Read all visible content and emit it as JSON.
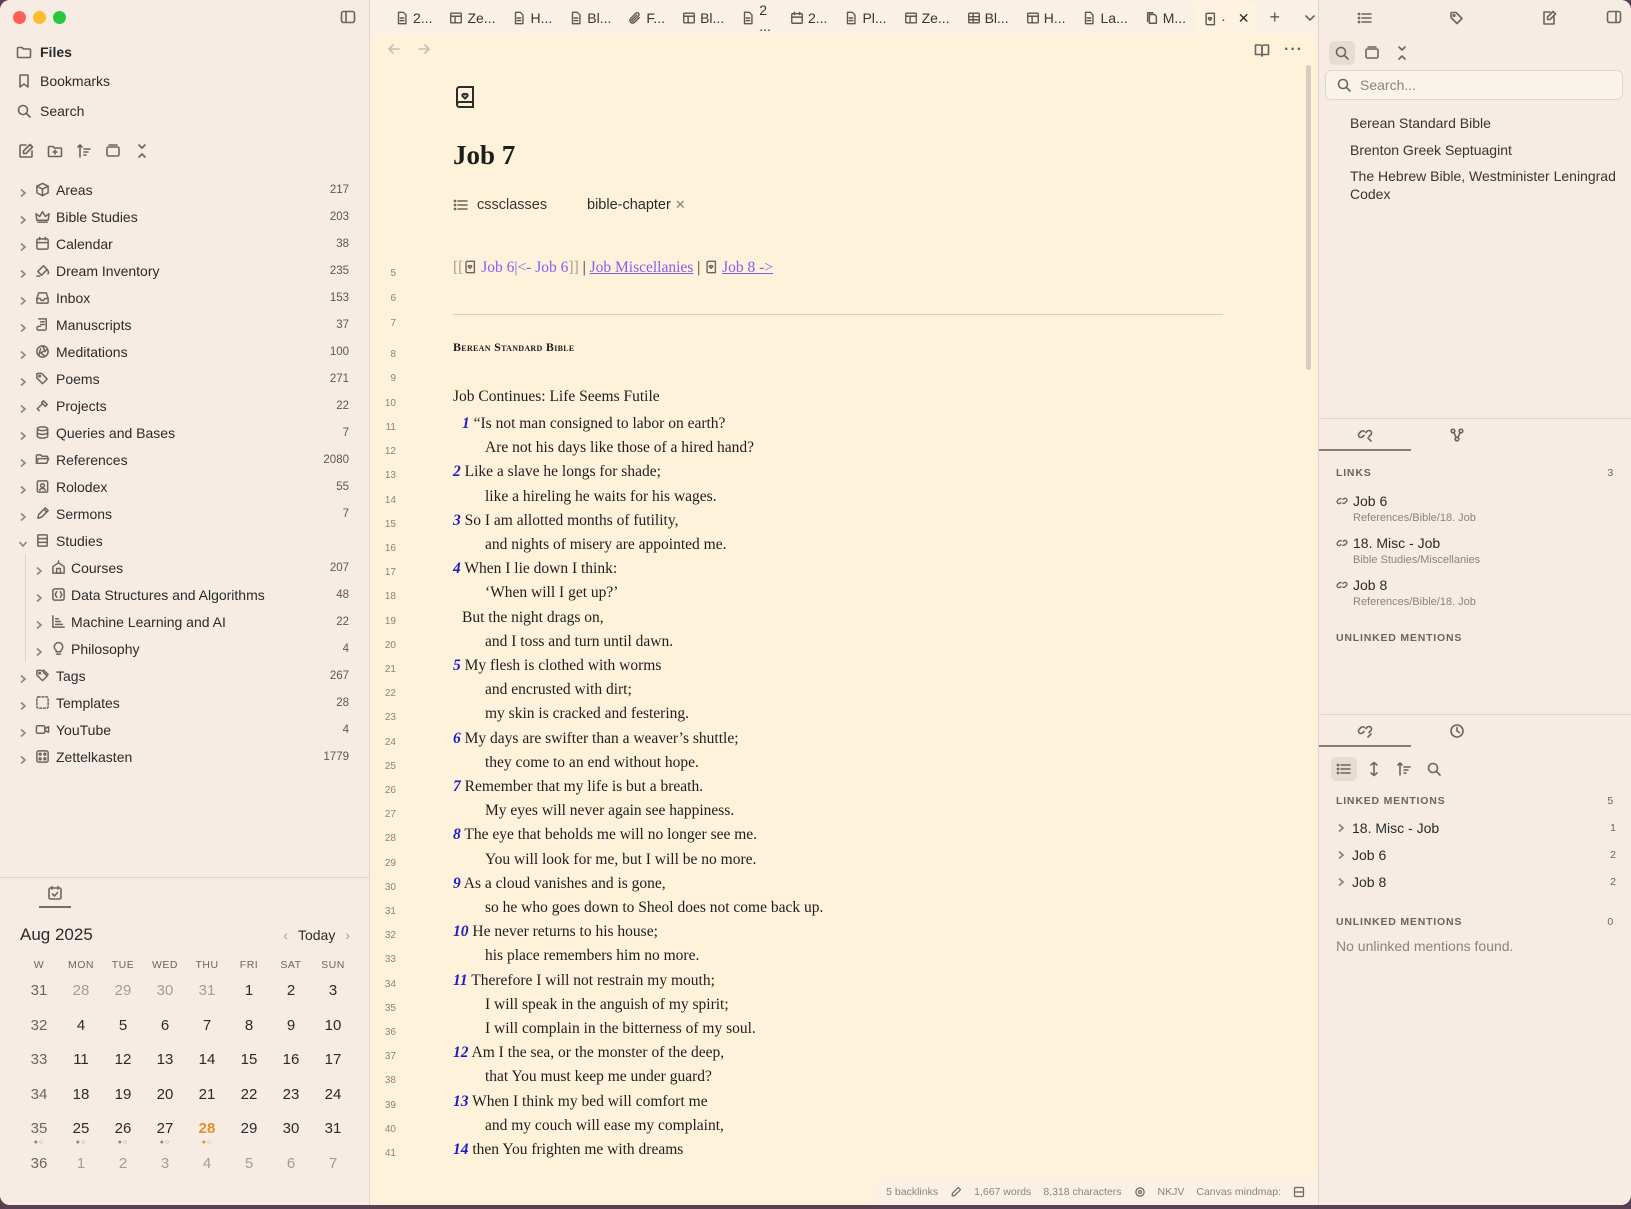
{
  "left_sidebar": {
    "nav": [
      {
        "label": "Files",
        "icon": "folder-icon"
      },
      {
        "label": "Bookmarks",
        "icon": "bookmark-icon"
      },
      {
        "label": "Search",
        "icon": "search-icon"
      }
    ],
    "tree": [
      {
        "label": "Areas",
        "count": "217",
        "icon": "box"
      },
      {
        "label": "Bible Studies",
        "count": "203",
        "icon": "crown"
      },
      {
        "label": "Calendar",
        "count": "38",
        "icon": "calendar"
      },
      {
        "label": "Dream Inventory",
        "count": "235",
        "icon": "paint"
      },
      {
        "label": "Inbox",
        "count": "153",
        "icon": "inbox"
      },
      {
        "label": "Manuscripts",
        "count": "37",
        "icon": "scroll"
      },
      {
        "label": "Meditations",
        "count": "100",
        "icon": "aperture"
      },
      {
        "label": "Poems",
        "count": "271",
        "icon": "tag"
      },
      {
        "label": "Projects",
        "count": "22",
        "icon": "hammer"
      },
      {
        "label": "Queries and Bases",
        "count": "7",
        "icon": "database"
      },
      {
        "label": "References",
        "count": "2080",
        "icon": "folder-open"
      },
      {
        "label": "Rolodex",
        "count": "55",
        "icon": "contact"
      },
      {
        "label": "Sermons",
        "count": "7",
        "icon": "pen"
      },
      {
        "label": "Studies",
        "count": "",
        "icon": "library"
      },
      {
        "label": "Courses",
        "count": "207",
        "icon": "school"
      },
      {
        "label": "Data Structures and Algorithms",
        "count": "48",
        "icon": "code"
      },
      {
        "label": "Machine Learning and AI",
        "count": "22",
        "icon": "chart"
      },
      {
        "label": "Philosophy",
        "count": "4",
        "icon": "bulb"
      },
      {
        "label": "Tags",
        "count": "267",
        "icon": "tags"
      },
      {
        "label": "Templates",
        "count": "28",
        "icon": "dashed"
      },
      {
        "label": "YouTube",
        "count": "4",
        "icon": "video"
      },
      {
        "label": "Zettelkasten",
        "count": "1779",
        "icon": "boxes"
      }
    ],
    "calendar": {
      "month": "Aug 2025",
      "today_label": "Today",
      "headers": [
        "W",
        "MON",
        "TUE",
        "WED",
        "THU",
        "FRI",
        "SAT",
        "SUN"
      ],
      "weeks": [
        [
          "31",
          "28",
          "29",
          "30",
          "31",
          "1",
          "2",
          "3"
        ],
        [
          "32",
          "4",
          "5",
          "6",
          "7",
          "8",
          "9",
          "10"
        ],
        [
          "33",
          "11",
          "12",
          "13",
          "14",
          "15",
          "16",
          "17"
        ],
        [
          "34",
          "18",
          "19",
          "20",
          "21",
          "22",
          "23",
          "24"
        ],
        [
          "35",
          "25",
          "26",
          "27",
          "28",
          "29",
          "30",
          "31"
        ],
        [
          "36",
          "1",
          "2",
          "3",
          "4",
          "5",
          "6",
          "7"
        ]
      ],
      "today": "28"
    }
  },
  "tabs": [
    {
      "label": "2...",
      "icon": "file"
    },
    {
      "label": "Ze...",
      "icon": "layout"
    },
    {
      "label": "H...",
      "icon": "file"
    },
    {
      "label": "Bl...",
      "icon": "file"
    },
    {
      "label": "F...",
      "icon": "paperclip"
    },
    {
      "label": "Bl...",
      "icon": "layout"
    },
    {
      "label": "2 ...",
      "icon": "file"
    },
    {
      "label": "2...",
      "icon": "calendar"
    },
    {
      "label": "Pl...",
      "icon": "file"
    },
    {
      "label": "Ze...",
      "icon": "layout"
    },
    {
      "label": "Bl...",
      "icon": "table"
    },
    {
      "label": "H...",
      "icon": "layout"
    },
    {
      "label": "La...",
      "icon": "file"
    },
    {
      "label": "M...",
      "icon": "files"
    },
    {
      "label": "·",
      "icon": "book"
    }
  ],
  "editor": {
    "title": "Job 7",
    "property_key": "cssclasses",
    "property_value": "bible-chapter",
    "nav_line": {
      "prev_link": "Job 6|<- Job 6",
      "misc_link": "Job Miscellanies",
      "next_link": "Job 8 ->"
    },
    "section_title": "Berean Standard Bible",
    "heading": "Job Continues: Life Seems Futile",
    "lines": [
      {
        "ln": "5"
      },
      {
        "ln": "6"
      },
      {
        "ln": "7"
      },
      {
        "ln": "8"
      },
      {
        "ln": "9"
      },
      {
        "ln": "10"
      },
      {
        "ln": "11",
        "v": "1",
        "text": "“Is not man consigned to labor on earth?",
        "kind": "mid"
      },
      {
        "ln": "12",
        "text": "Are not his days like those of a hired hand?",
        "kind": "indent"
      },
      {
        "ln": "13",
        "v": "2",
        "text": "Like a slave he longs for shade;",
        "kind": "first"
      },
      {
        "ln": "14",
        "text": "like a hireling he waits for his wages.",
        "kind": "indent"
      },
      {
        "ln": "15",
        "v": "3",
        "text": "So I am allotted months of futility,",
        "kind": "first"
      },
      {
        "ln": "16",
        "text": "and nights of misery are appointed me.",
        "kind": "indent"
      },
      {
        "ln": "17",
        "v": "4",
        "text": "When I lie down I think:",
        "kind": "first"
      },
      {
        "ln": "18",
        "text": "‘When will I get up?’",
        "kind": "indent"
      },
      {
        "ln": "19",
        "text": "But the night drags on,",
        "kind": "mid"
      },
      {
        "ln": "20",
        "text": "and I toss and turn until dawn.",
        "kind": "indent"
      },
      {
        "ln": "21",
        "v": "5",
        "text": "My flesh is clothed with worms",
        "kind": "first"
      },
      {
        "ln": "22",
        "text": "and encrusted with dirt;",
        "kind": "indent"
      },
      {
        "ln": "23",
        "text": "my skin is cracked and festering.",
        "kind": "indent"
      },
      {
        "ln": "24",
        "v": "6",
        "text": "My days are swifter than a weaver’s shuttle;",
        "kind": "first"
      },
      {
        "ln": "25",
        "text": "they come to an end without hope.",
        "kind": "indent"
      },
      {
        "ln": "26",
        "v": "7",
        "text": "Remember that my life is but a breath.",
        "kind": "first"
      },
      {
        "ln": "27",
        "text": "My eyes will never again see happiness.",
        "kind": "indent"
      },
      {
        "ln": "28",
        "v": "8",
        "text": "The eye that beholds me will no longer see me.",
        "kind": "first"
      },
      {
        "ln": "29",
        "text": "You will look for me, but I will be no more.",
        "kind": "indent"
      },
      {
        "ln": "30",
        "v": "9",
        "text": "As a cloud vanishes and is gone,",
        "kind": "first"
      },
      {
        "ln": "31",
        "text": "so he who goes down to Sheol does not come back up.",
        "kind": "indent"
      },
      {
        "ln": "32",
        "v": "10",
        "text": "He never returns to his house;",
        "kind": "first"
      },
      {
        "ln": "33",
        "text": "his place remembers him no more.",
        "kind": "indent"
      },
      {
        "ln": "34",
        "v": "11",
        "text": "Therefore I will not restrain my mouth;",
        "kind": "first"
      },
      {
        "ln": "35",
        "text": "I will speak in the anguish of my spirit;",
        "kind": "indent"
      },
      {
        "ln": "36",
        "text": "I will complain in the bitterness of my soul.",
        "kind": "indent"
      },
      {
        "ln": "37",
        "v": "12",
        "text": "Am I the sea, or the monster of the deep,",
        "kind": "first"
      },
      {
        "ln": "38",
        "text": "that You must keep me under guard?",
        "kind": "indent"
      },
      {
        "ln": "39",
        "v": "13",
        "text": "When I think my bed will comfort me",
        "kind": "first"
      },
      {
        "ln": "40",
        "text": "and my couch will ease my complaint,",
        "kind": "indent"
      },
      {
        "ln": "41",
        "v": "14",
        "text": "then You frighten me with dreams",
        "kind": "first"
      }
    ]
  },
  "status_bar": {
    "backlinks": "5 backlinks",
    "words": "1,667 words",
    "characters": "8,318 characters",
    "version": "NKJV",
    "canvas": "Canvas mindmap:"
  },
  "right_sidebar": {
    "search_placeholder": "Search...",
    "bookmarks": [
      "Berean Standard Bible",
      "Brenton Greek Septuagint",
      "The Hebrew Bible, Westminister Leningrad Codex"
    ],
    "links_header": "LINKS",
    "links_count": "3",
    "links": [
      {
        "title": "Job 6",
        "path": "References/Bible/18. Job"
      },
      {
        "title": "18. Misc - Job",
        "path": "Bible Studies/Miscellanies"
      },
      {
        "title": "Job 8",
        "path": "References/Bible/18. Job"
      }
    ],
    "unlinked_header": "UNLINKED MENTIONS",
    "linked_mentions_header": "LINKED MENTIONS",
    "linked_mentions_count": "5",
    "linked_mentions": [
      {
        "title": "18. Misc - Job",
        "count": "1"
      },
      {
        "title": "Job 6",
        "count": "2"
      },
      {
        "title": "Job 8",
        "count": "2"
      }
    ],
    "unlinked_mentions_header": "UNLINKED MENTIONS",
    "unlinked_mentions_count": "0",
    "no_unlinked": "No unlinked mentions found."
  }
}
